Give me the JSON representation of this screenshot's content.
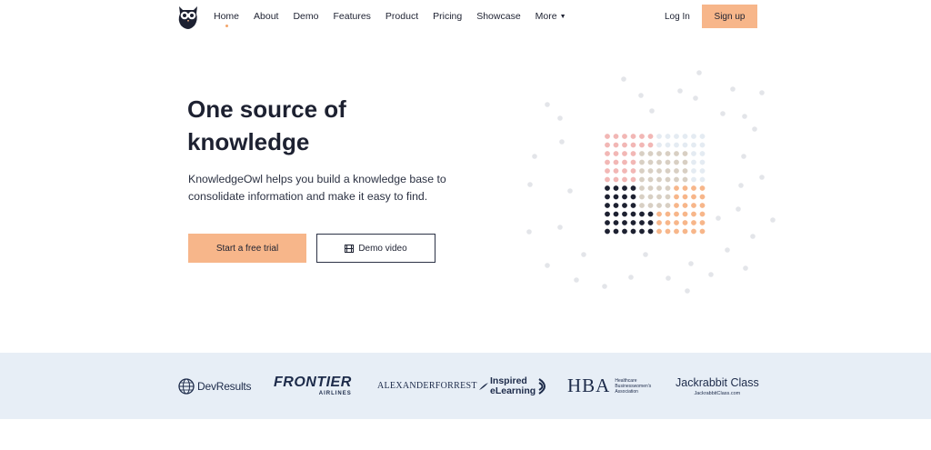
{
  "nav": {
    "items": [
      {
        "label": "Home",
        "active": true
      },
      {
        "label": "About"
      },
      {
        "label": "Demo"
      },
      {
        "label": "Features"
      },
      {
        "label": "Product"
      },
      {
        "label": "Pricing"
      },
      {
        "label": "Showcase"
      },
      {
        "label": "More",
        "has_dropdown": true
      }
    ],
    "login_label": "Log In",
    "signup_label": "Sign up",
    "logo_icon": "owl-logo-icon"
  },
  "hero": {
    "title": "One source of knowledge",
    "subtitle": "KnowledgeOwl helps you build a knowledge base to consolidate information and make it easy to find.",
    "primary_cta": "Start a free trial",
    "secondary_cta": "Demo video",
    "secondary_cta_icon": "film-icon"
  },
  "clients": {
    "devresults": "DevResults",
    "frontier": {
      "name": "FRONTIER",
      "sub": "AIRLINES"
    },
    "alexander_forrest": "ALEXANDERFORREST",
    "inspired_elearning": {
      "line1": "Inspired",
      "line2": "eLearning"
    },
    "hba": {
      "mark": "HBA",
      "line1": "Healthcare",
      "line2": "Businesswomen's",
      "line3": "Association"
    },
    "jackrabbit": {
      "name": "Jackrabbit Class",
      "url": "JackrabbitClass.com"
    }
  },
  "colors": {
    "accent": "#f7b68a",
    "dark": "#1d2131",
    "pink": "#f2b7b5",
    "beige": "#d8cfc3",
    "light_blue": "#e4ebf2",
    "orange_dot": "#f7b68a",
    "scatter_dot": "#e3e5e9",
    "logo_bar_bg": "#e7eef6"
  }
}
